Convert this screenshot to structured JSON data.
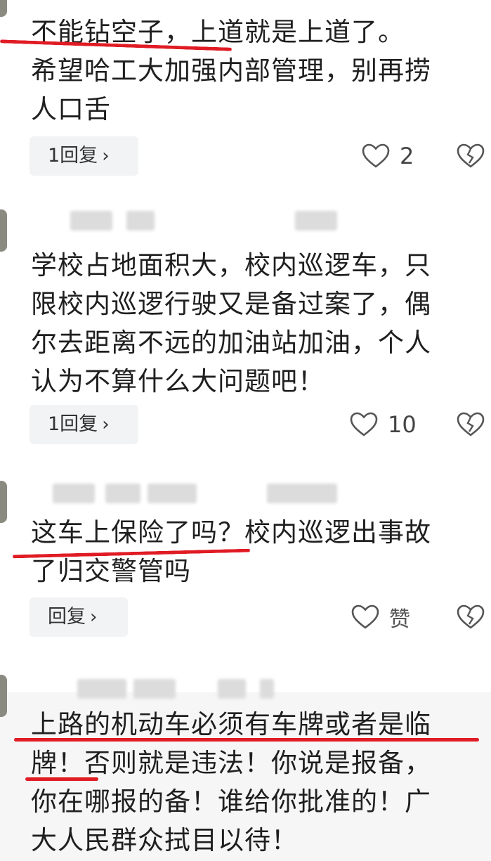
{
  "comments": [
    {
      "text": "不能钻空子，上道就是上道了。\n希望哈工大加强内部管理，别再捞\n人口舌",
      "reply_label": "1回复",
      "like_count": "2"
    },
    {
      "text": "学校占地面积大，校内巡逻车，只\n限校内巡逻行驶又是备过案了，偶\n尔去距离不远的加油站加油，个人\n认为不算什么大问题吧！",
      "reply_label": "1回复",
      "like_count": "10"
    },
    {
      "text": "这车上保险了吗？校内巡逻出事故\n了归交警管吗",
      "reply_label": "回复",
      "like_count": "赞"
    },
    {
      "text": "上路的机动车必须有车牌或者是临\n牌！否则就是违法！你说是报备，\n你在哪报的备！谁给你批准的！广\n大人民群众拭目以待！"
    }
  ],
  "chevron": "›",
  "icons": {
    "like": "heart-outline-icon",
    "dislike": "broken-heart-icon",
    "chevron": "chevron-right-icon"
  },
  "colors": {
    "annotation": "#e01b24",
    "pill_bg": "#f2f3f5",
    "text": "#1f1f1f"
  }
}
